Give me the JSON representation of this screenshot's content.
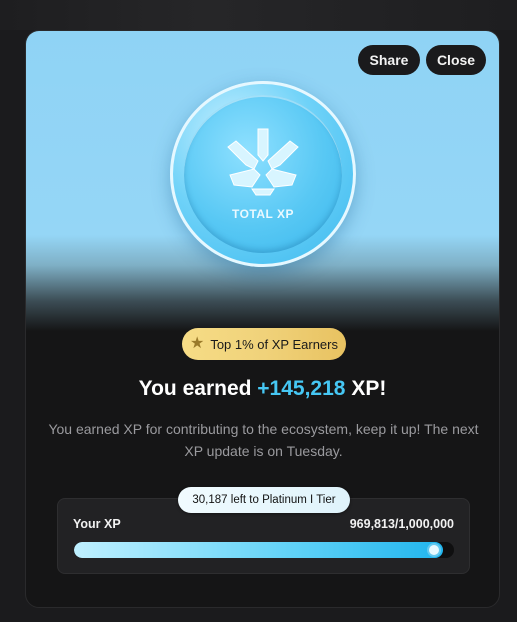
{
  "actions": {
    "share_label": "Share",
    "close_label": "Close"
  },
  "coin": {
    "label": "TOTAL XP",
    "icon": "total-xp-logo-icon"
  },
  "badge": {
    "icon": "star-icon",
    "text": "Top 1% of XP Earners"
  },
  "headline": {
    "prefix": "You earned ",
    "amount": "+145,218",
    "suffix": " XP!"
  },
  "description": "You earned XP for contributing to the ecosystem, keep it up! The next XP update is on Tuesday.",
  "xp": {
    "tooltip": "30,187 left to Platinum I Tier",
    "label": "Your XP",
    "value_text": "969,813/1,000,000",
    "current": 969813,
    "target": 1000000
  },
  "colors": {
    "accent": "#46c7f4",
    "badge_gold": "#f0d27a",
    "hero_sky": "#95d6f6"
  }
}
